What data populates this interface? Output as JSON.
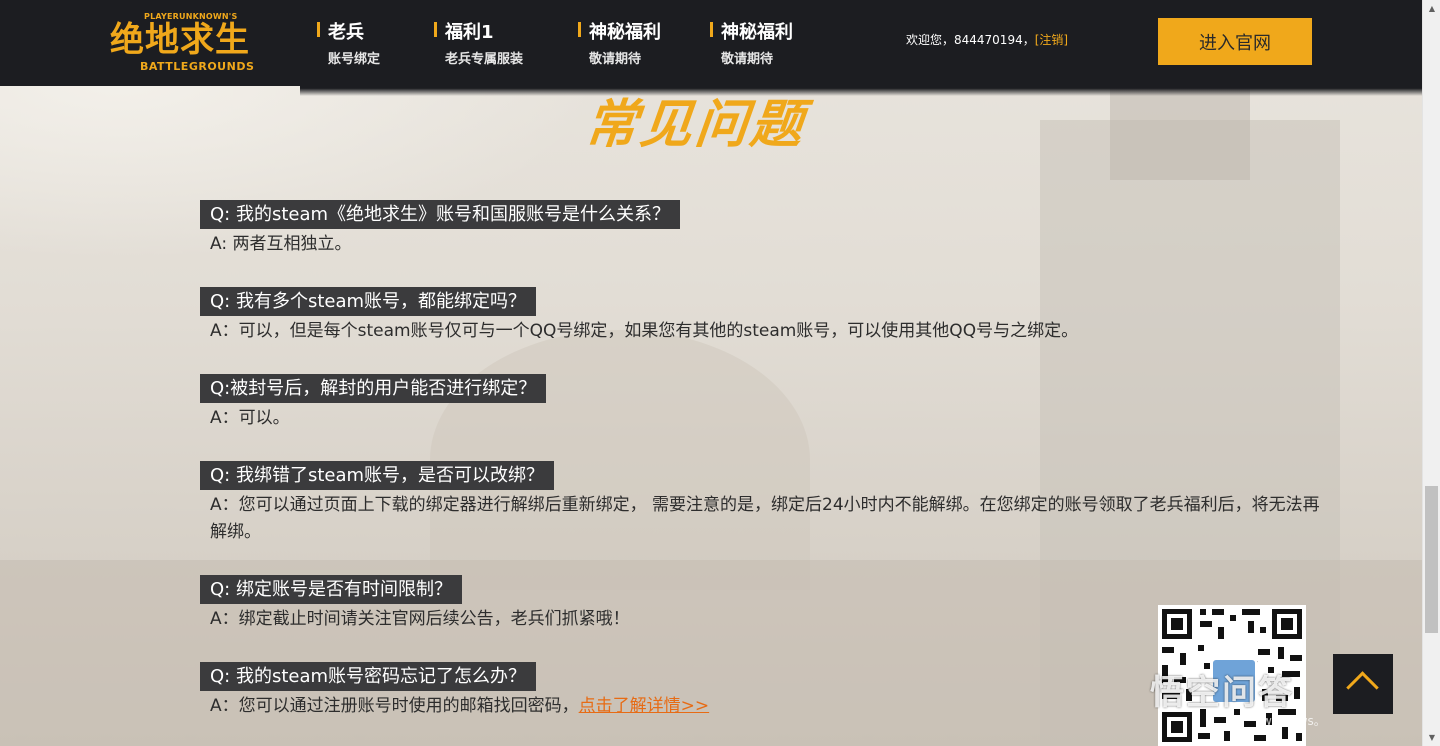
{
  "brand": {
    "logo_top": "PLAYERUNKNOWN'S",
    "logo_main": "绝地求生",
    "logo_bottom": "BATTLEGROUNDS",
    "accent_color": "#f0a81b",
    "header_bg": "#1c1d21"
  },
  "nav": [
    {
      "title": "老兵",
      "sub": "账号绑定"
    },
    {
      "title": "福利1",
      "sub": "老兵专属服装"
    },
    {
      "title": "神秘福利",
      "sub": "敬请期待"
    },
    {
      "title": "神秘福利",
      "sub": "敬请期待"
    }
  ],
  "user": {
    "welcome": "欢迎您，844470194，",
    "logout": "[注销]"
  },
  "enter_button": "进入官网",
  "section_title": "常见问题",
  "faq": [
    {
      "q": "Q: 我的steam《绝地求生》账号和国服账号是什么关系？",
      "a": "A: 两者互相独立。"
    },
    {
      "q": "Q: 我有多个steam账号，都能绑定吗？",
      "a": "A：可以，但是每个steam账号仅可与一个QQ号绑定，如果您有其他的steam账号，可以使用其他QQ号与之绑定。"
    },
    {
      "q": "Q:被封号后，解封的用户能否进行绑定？",
      "a": "A：可以。"
    },
    {
      "q": "Q: 我绑错了steam账号，是否可以改绑？",
      "a": "A：您可以通过页面上下载的绑定器进行解绑后重新绑定， 需要注意的是，绑定后24小时内不能解绑。在您绑定的账号领取了老兵福利后，将无法再解绑。"
    },
    {
      "q": "Q: 绑定账号是否有时间限制？",
      "a": "A：绑定截止时间请关注官网后续公告，老兵们抓紧哦！"
    },
    {
      "q": "Q: 我的steam账号密码忘记了怎么办？",
      "a": "A：您可以通过注册账号时使用的邮箱找回密码，",
      "link": "点击了解详情>>"
    }
  ],
  "watermark": {
    "text": "悟空问答",
    "sub": "windows。"
  }
}
